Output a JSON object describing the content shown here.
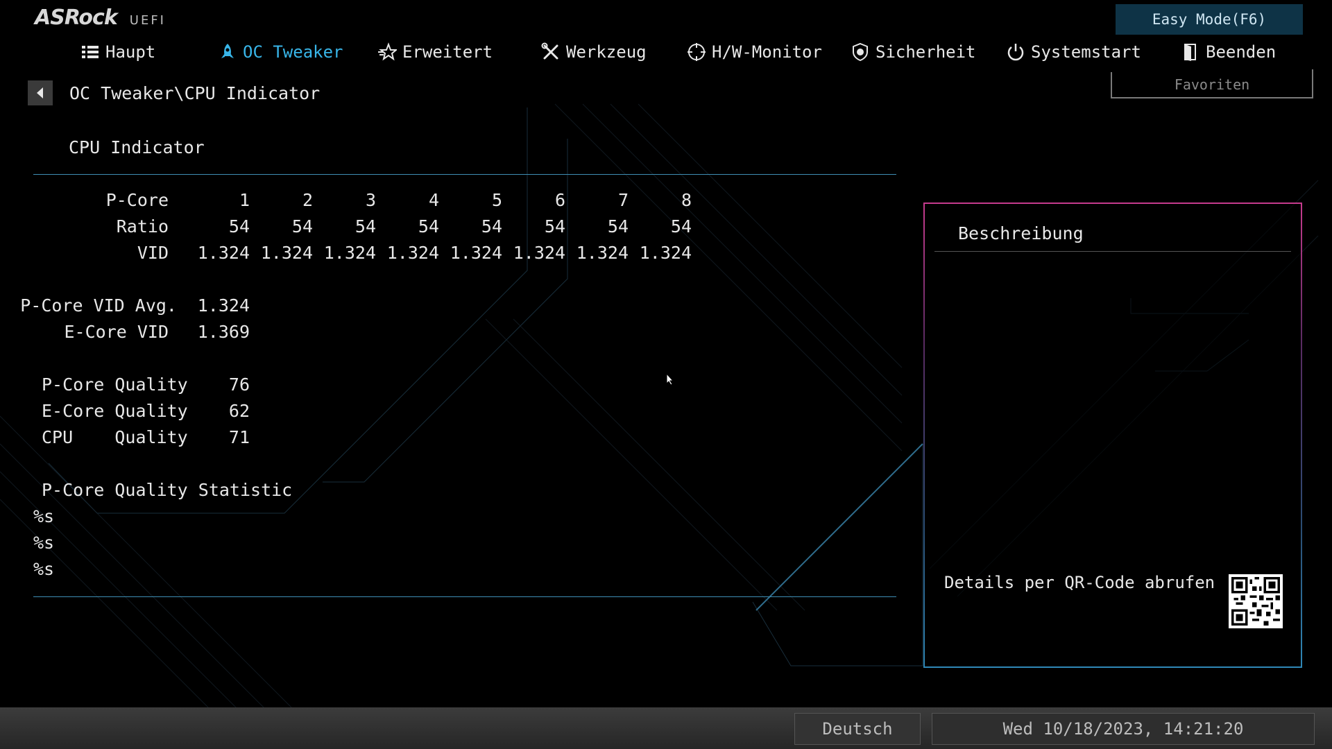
{
  "header": {
    "logo_brand": "ASRock",
    "logo_suffix": "UEFI",
    "easy_mode": "Easy Mode(F6)",
    "favorites": "Favoriten"
  },
  "nav": {
    "items": [
      {
        "label": "Haupt",
        "icon": "list-icon"
      },
      {
        "label": "OC Tweaker",
        "icon": "rocket-icon",
        "active": true
      },
      {
        "label": "Erweitert",
        "icon": "star-icon"
      },
      {
        "label": "Werkzeug",
        "icon": "tools-icon"
      },
      {
        "label": "H/W-Monitor",
        "icon": "crosshair-icon"
      },
      {
        "label": "Sicherheit",
        "icon": "shield-icon"
      },
      {
        "label": "Systemstart",
        "icon": "power-icon"
      },
      {
        "label": "Beenden",
        "icon": "exit-door-icon"
      }
    ]
  },
  "breadcrumb": "OC Tweaker\\CPU Indicator",
  "section_title": "CPU Indicator",
  "table": {
    "header_label": "P-Core",
    "cores": [
      "1",
      "2",
      "3",
      "4",
      "5",
      "6",
      "7",
      "8"
    ],
    "ratio_label": "Ratio",
    "ratios": [
      "54",
      "54",
      "54",
      "54",
      "54",
      "54",
      "54",
      "54"
    ],
    "vid_label": "VID",
    "vids": [
      "1.324",
      "1.324",
      "1.324",
      "1.324",
      "1.324",
      "1.324",
      "1.324",
      "1.324"
    ]
  },
  "summary": {
    "pcore_vid_avg_label": "P-Core VID Avg.",
    "pcore_vid_avg": "1.324",
    "ecore_vid_label": "E-Core VID",
    "ecore_vid": "1.369",
    "pcore_quality_label": "P-Core Quality",
    "pcore_quality": "76",
    "ecore_quality_label": "E-Core Quality",
    "ecore_quality": "62",
    "cpu_quality_label": "CPU    Quality",
    "cpu_quality": "71",
    "statistic_label": "P-Core Quality Statistic",
    "statistic_lines": [
      "%s",
      "%s",
      "%s"
    ]
  },
  "description": {
    "title": "Beschreibung",
    "qr_label": "Details per QR-Code abrufen"
  },
  "footer": {
    "language": "Deutsch",
    "datetime": "Wed 10/18/2023, 14:21:20"
  },
  "colors": {
    "accent": "#38b5e8",
    "divider": "#3f8fb5",
    "easy_mode_bg": "#0e3346"
  }
}
